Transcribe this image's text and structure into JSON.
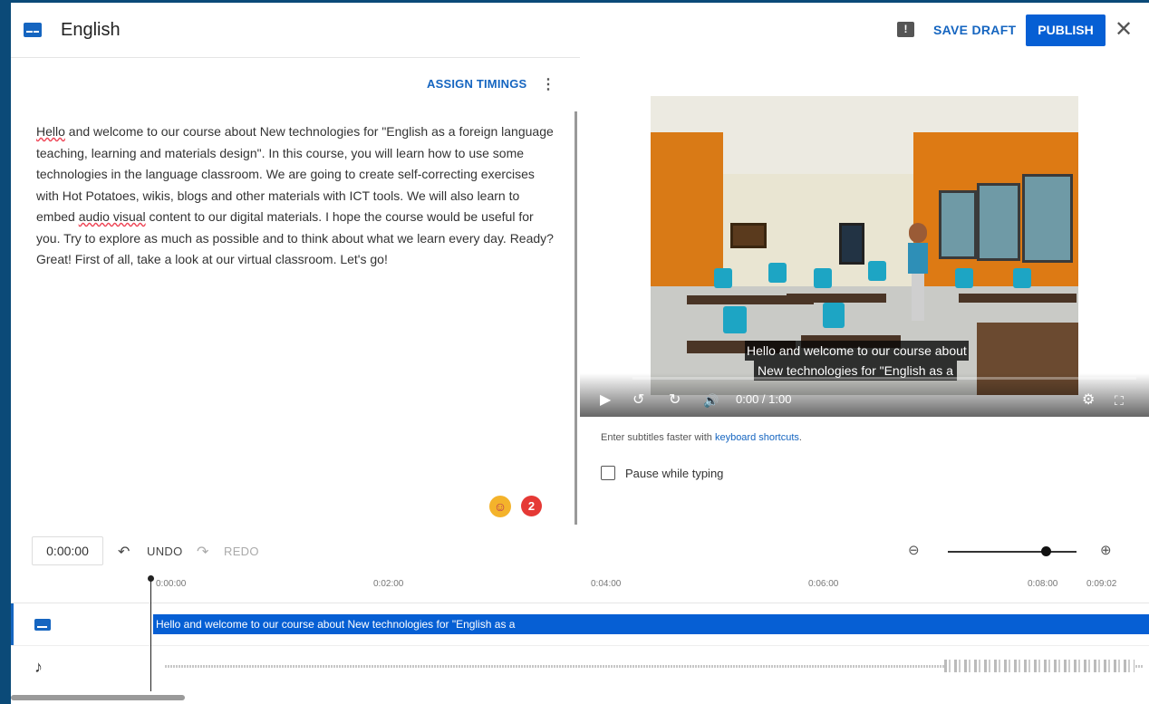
{
  "header": {
    "title": "English",
    "save_draft": "SAVE DRAFT",
    "publish": "PUBLISH",
    "close_glyph": "✕",
    "feedback_glyph": "!"
  },
  "editor": {
    "assign_timings": "ASSIGN TIMINGS",
    "more_glyph": "⋮",
    "transcript": {
      "w1": "Hello",
      "p1": " and welcome to our course about New technologies for \"English as a foreign language teaching, learning and materials design\". In this course, you will learn how to use some technologies in the language classroom. We are going to create self-correcting exercises with Hot Potatoes, wikis, blogs and other materials with ICT tools. We will also learn to embed ",
      "w2": "audio visual",
      "p2": " content to our digital materials. I hope the course would be useful for you. Try to explore as much as possible and to think about what we learn every day. Ready? Great! First of all, take a look at our virtual classroom. Let's go!"
    },
    "badge_count": "2"
  },
  "player": {
    "caption_line1": "Hello and welcome to our course about",
    "caption_line2": "New technologies for \"English as a",
    "time": "0:00 / 1:00",
    "play_glyph": "▶",
    "rewind_glyph": "↺",
    "forward_glyph": "↻",
    "volume_glyph": "🔊",
    "settings_glyph": "⚙",
    "fullscreen_glyph": "⛶"
  },
  "options": {
    "hint_prefix": "Enter subtitles faster with ",
    "hint_link": "keyboard shortcuts",
    "hint_suffix": ".",
    "pause_while_typing": "Pause while typing",
    "pause_checked": false
  },
  "timeline": {
    "timecode": "0:00:00",
    "undo": "UNDO",
    "redo": "REDO",
    "zoom_out_glyph": "⊖",
    "zoom_in_glyph": "⊕",
    "zoom_level": 0.78,
    "ticks": [
      "0:00:00",
      "0:02:00",
      "0:04:00",
      "0:06:00",
      "0:08:00",
      "0:09:02"
    ],
    "subtitle_segment": "Hello and welcome to our course about  New technologies for \"English as a",
    "music_glyph": "♪"
  },
  "colors": {
    "accent": "#065fd4",
    "link": "#1565c0",
    "badge": "#e53935"
  }
}
